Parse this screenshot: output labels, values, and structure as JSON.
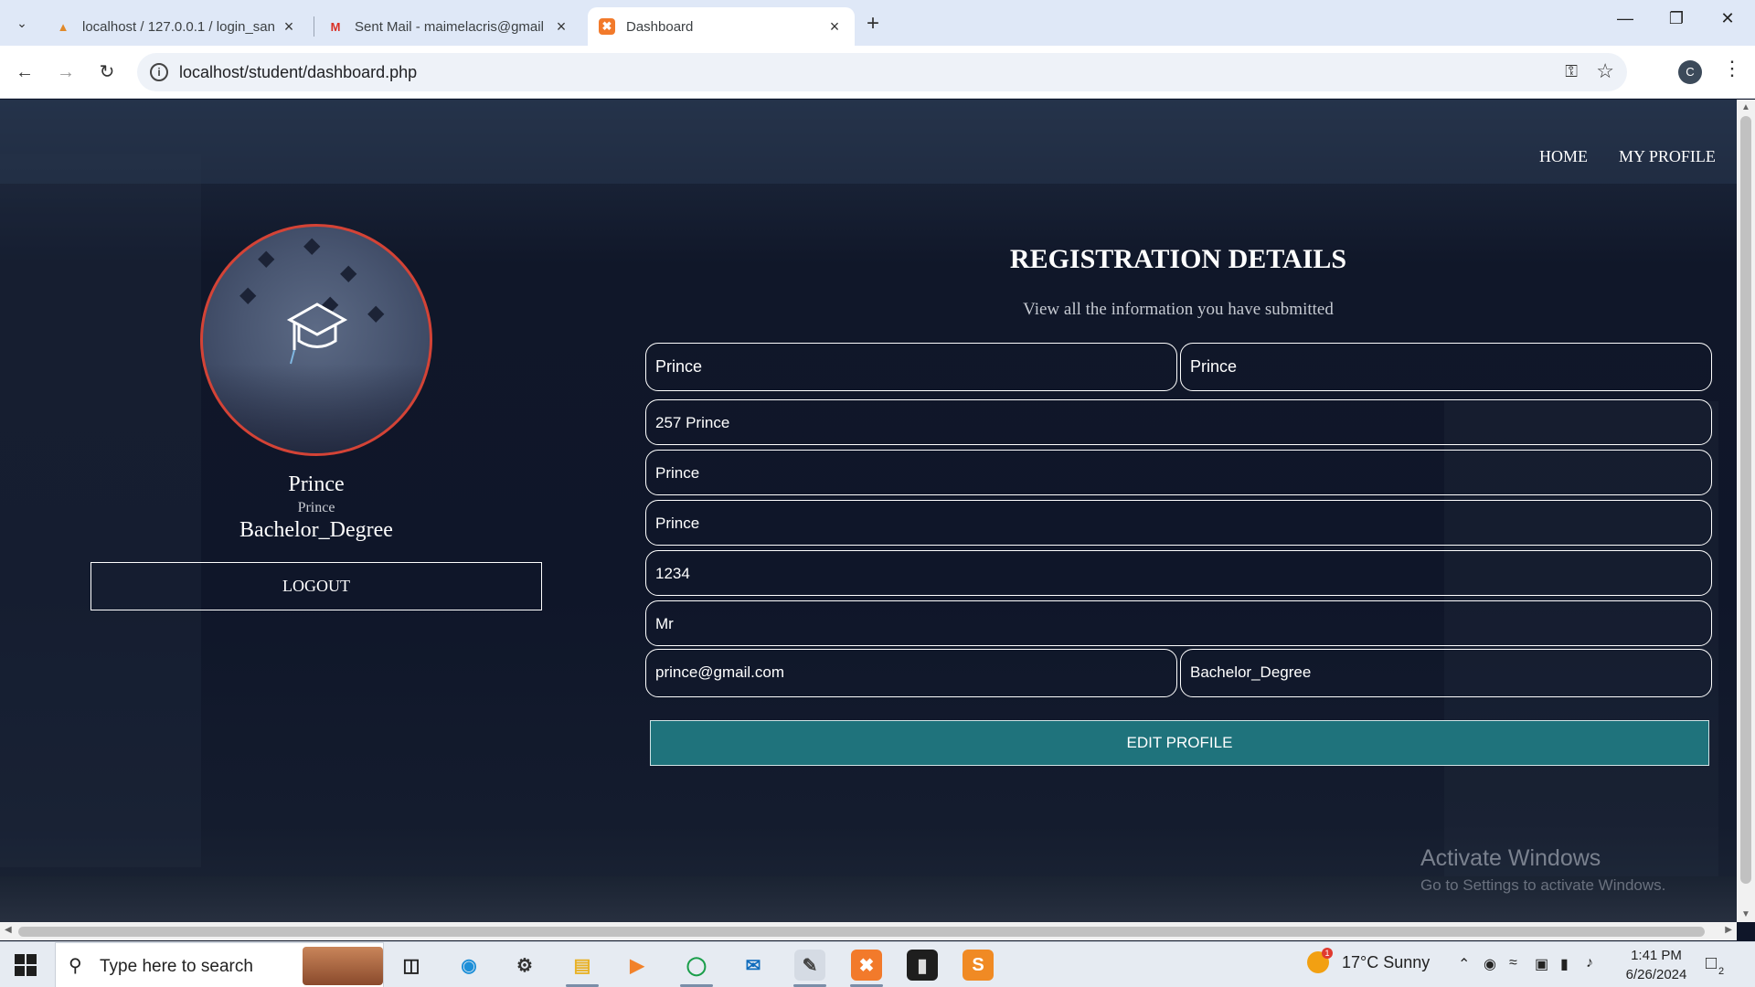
{
  "browser": {
    "tabs": [
      {
        "title": "localhost / 127.0.0.1 / login_san",
        "icon": "phpmyadmin-icon"
      },
      {
        "title": "Sent Mail - maimelacris@gmail",
        "icon": "gmail-icon"
      },
      {
        "title": "Dashboard",
        "icon": "xampp-icon"
      }
    ],
    "url": "localhost/student/dashboard.php",
    "profile_initial": "C"
  },
  "nav": {
    "home": "HOME",
    "profile": "MY PROFILE"
  },
  "profile": {
    "name": "Prince",
    "sub": "Prince",
    "degree": "Bachelor_Degree",
    "logout": "LOGOUT"
  },
  "registration": {
    "title": "REGISTRATION DETAILS",
    "subtitle": "View all the information you have submitted",
    "first_name": "Prince",
    "last_name": "Prince",
    "address": "257 Prince",
    "field3": "Prince",
    "field4": "Prince",
    "field5": "1234",
    "title_field": "Mr",
    "email": "prince@gmail.com",
    "course": "Bachelor_Degree",
    "edit_button": "EDIT PROFILE"
  },
  "watermark": {
    "line1": "Activate Windows",
    "line2": "Go to Settings to activate Windows."
  },
  "taskbar": {
    "search_placeholder": "Type here to search",
    "weather": "17°C  Sunny",
    "weather_badge": "1",
    "time": "1:41 PM",
    "date": "6/26/2024",
    "notifications": "2"
  },
  "colors": {
    "accent_button": "#1f737c",
    "avatar_border": "#d44336",
    "page_bg": "#0f1629"
  }
}
